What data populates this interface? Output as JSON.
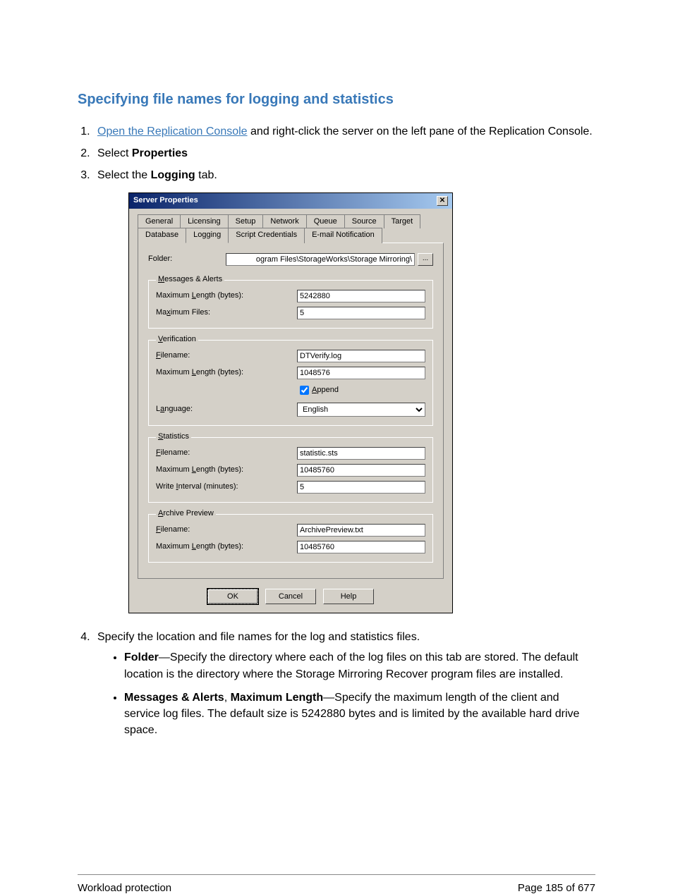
{
  "heading": "Specifying file names for logging and statistics",
  "steps": {
    "s1_link": "Open the Replication Console",
    "s1_rest": " and right-click the server on the left pane of the Replication Console.",
    "s2_pre": "Select ",
    "s2_bold": "Properties",
    "s3_pre": "Select the ",
    "s3_bold": "Logging",
    "s3_post": " tab.",
    "s4": "Specify the location and file names for the log and statistics files."
  },
  "bullets": {
    "b1_bold": "Folder",
    "b1_text": "—Specify the directory where each of the log files on this tab are stored. The default location is the directory where the Storage Mirroring Recover program files are installed.",
    "b2_bold1": "Messages & Alerts",
    "b2_sep": ", ",
    "b2_bold2": "Maximum Length",
    "b2_text": "—Specify the maximum length of the client and service log files. The default size is 5242880 bytes and is limited by the available hard drive space."
  },
  "dialog": {
    "title": "Server Properties",
    "tabs_row1": [
      "General",
      "Licensing",
      "Setup",
      "Network",
      "Queue",
      "Source",
      "Target"
    ],
    "tabs_row2": [
      "Database",
      "Logging",
      "Script Credentials",
      "E-mail Notification"
    ],
    "folder_label": "Folder:",
    "folder_value": "ogram Files\\StorageWorks\\Storage Mirroring\\",
    "browse": "...",
    "groups": {
      "messages": {
        "legend": "Messages & Alerts",
        "max_len_label": "Maximum Length (bytes):",
        "max_len_value": "5242880",
        "max_files_label": "Maximum Files:",
        "max_files_value": "5"
      },
      "verification": {
        "legend": "Verification",
        "filename_label": "Filename:",
        "filename_value": "DTVerify.log",
        "max_len_label": "Maximum Length (bytes):",
        "max_len_value": "1048576",
        "append_label": "Append",
        "language_label": "Language:",
        "language_value": "English"
      },
      "statistics": {
        "legend": "Statistics",
        "filename_label": "Filename:",
        "filename_value": "statistic.sts",
        "max_len_label": "Maximum Length (bytes):",
        "max_len_value": "10485760",
        "write_interval_label": "Write Interval (minutes):",
        "write_interval_value": "5"
      },
      "archive": {
        "legend": "Archive Preview",
        "filename_label": "Filename:",
        "filename_value": "ArchivePreview.txt",
        "max_len_label": "Maximum Length (bytes):",
        "max_len_value": "10485760"
      }
    },
    "buttons": {
      "ok": "OK",
      "cancel": "Cancel",
      "help": "Help"
    }
  },
  "footer": {
    "left": "Workload protection",
    "right": "Page 185 of 677"
  }
}
